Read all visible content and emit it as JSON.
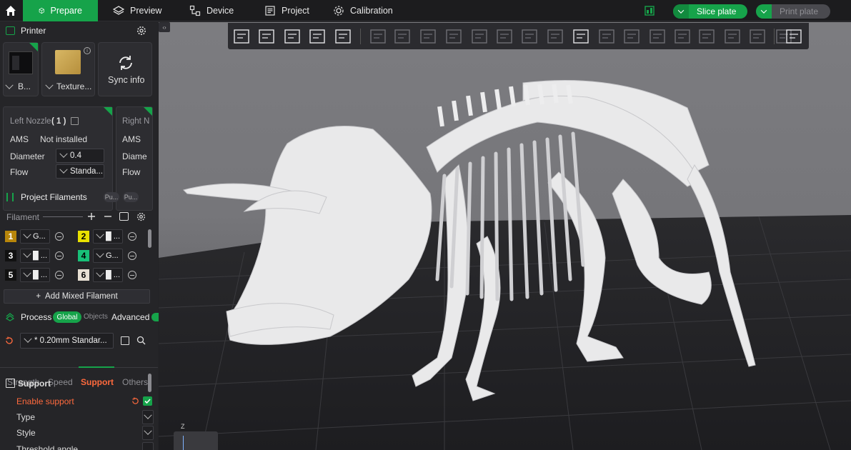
{
  "tabs": [
    {
      "label": "Prepare",
      "icon": "cube-icon"
    },
    {
      "label": "Preview",
      "icon": "layers-icon"
    },
    {
      "label": "Device",
      "icon": "device-icon"
    },
    {
      "label": "Project",
      "icon": "project-icon"
    },
    {
      "label": "Calibration",
      "icon": "calibration-icon"
    }
  ],
  "actions": {
    "slice": "Slice plate",
    "print": "Print plate"
  },
  "printer": {
    "title": "Printer",
    "printer_name": "B...",
    "plate_name": "Texture...",
    "sync": "Sync info"
  },
  "nozzles": {
    "left_title": "Left Nozzle",
    "left_index": "( 1 )",
    "right_title": "Right N",
    "ams_label": "AMS",
    "ams_value": "Not installed",
    "diameter_label": "Diameter",
    "diameter_value": "0.4",
    "flow_label": "Flow",
    "flow_value": "Standa...",
    "right_ams": "AMS",
    "right_diameter": "Diame",
    "right_flow": "Flow"
  },
  "filaments": {
    "title": "Project Filaments",
    "pill1": "Pu...",
    "pill2": "Pu...",
    "section_label": "Filament",
    "add_mixed": "Add Mixed Filament",
    "items": [
      {
        "num": "1",
        "name": "G...",
        "color": "#b8860b",
        "text": "#fff"
      },
      {
        "num": "2",
        "name": "█ ...",
        "color": "#e8e000",
        "text": "#000"
      },
      {
        "num": "3",
        "name": "█ ...",
        "color": "#111111",
        "text": "#fff"
      },
      {
        "num": "4",
        "name": "G...",
        "color": "#18c078",
        "text": "#000"
      },
      {
        "num": "5",
        "name": "█ ...",
        "color": "#111111",
        "text": "#fff"
      },
      {
        "num": "6",
        "name": "█ ...",
        "color": "#e8e0d4",
        "text": "#000"
      }
    ]
  },
  "process": {
    "title": "Process",
    "global": "Global",
    "objects": "Objects",
    "advanced": "Advanced",
    "preset": "* 0.20mm Standar...",
    "tabs": [
      "Strength",
      "Speed",
      "Support",
      "Others"
    ],
    "active_tab": "Support"
  },
  "support": {
    "title": "Support",
    "rows": [
      "Enable support",
      "Type",
      "Style",
      "Threshold angle"
    ]
  },
  "viewport": {
    "axis_label": "Z"
  },
  "colors": {
    "accent": "#16a34a",
    "highlight": "#ff6a3d"
  }
}
